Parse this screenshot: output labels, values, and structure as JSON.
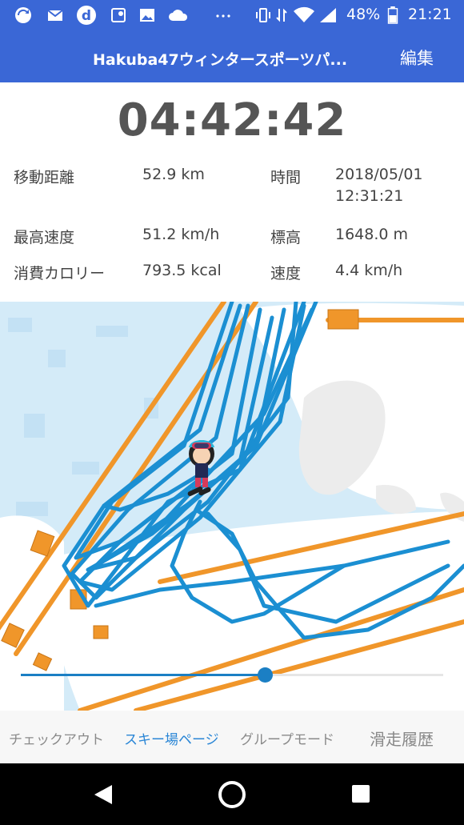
{
  "status_bar": {
    "battery_percent": "48%",
    "time": "21:21",
    "icons": [
      "sync-icon",
      "mail-icon",
      "d-app-icon",
      "maps-icon",
      "image-icon",
      "cloud-icon",
      "more-icon",
      "vibrate-icon",
      "data-icon",
      "wifi-icon",
      "signal-icon",
      "battery-icon"
    ]
  },
  "app_bar": {
    "title": "Hakuba47ウィンタースポーツパ...",
    "edit_label": "編集"
  },
  "summary": {
    "elapsed_time": "04:42:42",
    "stats": {
      "distance_label": "移動距離",
      "distance_value": "52.9 km",
      "time_label": "時間",
      "time_date": "2018/05/01",
      "time_clock": "12:31:21",
      "max_speed_label": "最高速度",
      "max_speed_value": "51.2 km/h",
      "altitude_label": "標高",
      "altitude_value": "1648.0 m",
      "calories_label": "消費カロリー",
      "calories_value": "793.5 kcal",
      "speed_label": "速度",
      "speed_value": "4.4 km/h"
    }
  },
  "map": {
    "track_color": "#1b8fd2",
    "lift_color": "#f0962a",
    "marker": "skier-avatar-icon"
  },
  "playback": {
    "progress": 0.58
  },
  "tabs": {
    "checkout": "チェックアウト",
    "ski_page": "スキー場ページ",
    "group_mode": "グループモード",
    "history": "滑走履歴",
    "active": "ski_page"
  },
  "nav": {
    "icons": [
      "back-icon",
      "home-icon",
      "recents-icon"
    ]
  }
}
